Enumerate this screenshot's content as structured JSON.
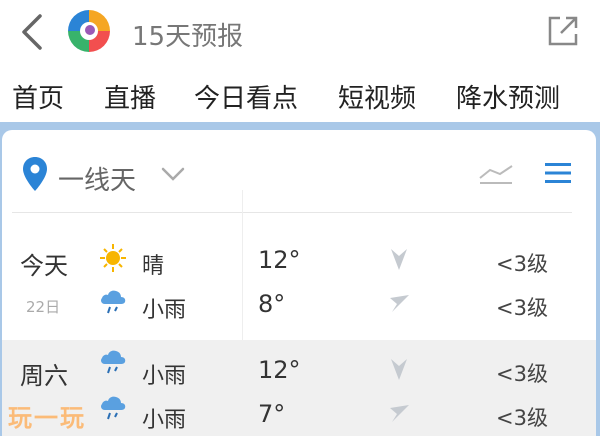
{
  "header": {
    "title": "15天预报",
    "back_icon": "chevron-left-icon",
    "share_icon": "external-link-icon"
  },
  "nav": {
    "items": [
      "首页",
      "直播",
      "今日看点",
      "短视频",
      "降水预测"
    ]
  },
  "location": {
    "name": "一线天"
  },
  "forecast": [
    {
      "day": "今天",
      "date": "",
      "condition": "晴",
      "icon": "sun-icon",
      "temp": "12°",
      "wind": "<3级"
    },
    {
      "day": "",
      "date": "22日",
      "condition": "小雨",
      "icon": "rain-cloud-icon",
      "temp": "8°",
      "wind": "<3级"
    },
    {
      "day": "周六",
      "date": "",
      "condition": "小雨",
      "icon": "rain-cloud-icon",
      "temp": "12°",
      "wind": "<3级"
    },
    {
      "day": "",
      "date": "",
      "condition": "小雨",
      "icon": "rain-cloud-icon",
      "temp": "7°",
      "wind": "<3级"
    }
  ],
  "watermark": "玩一玩",
  "colors": {
    "accent": "#2b84d6",
    "sun": "#f7b500",
    "card_bg": "#a9c8e8"
  }
}
